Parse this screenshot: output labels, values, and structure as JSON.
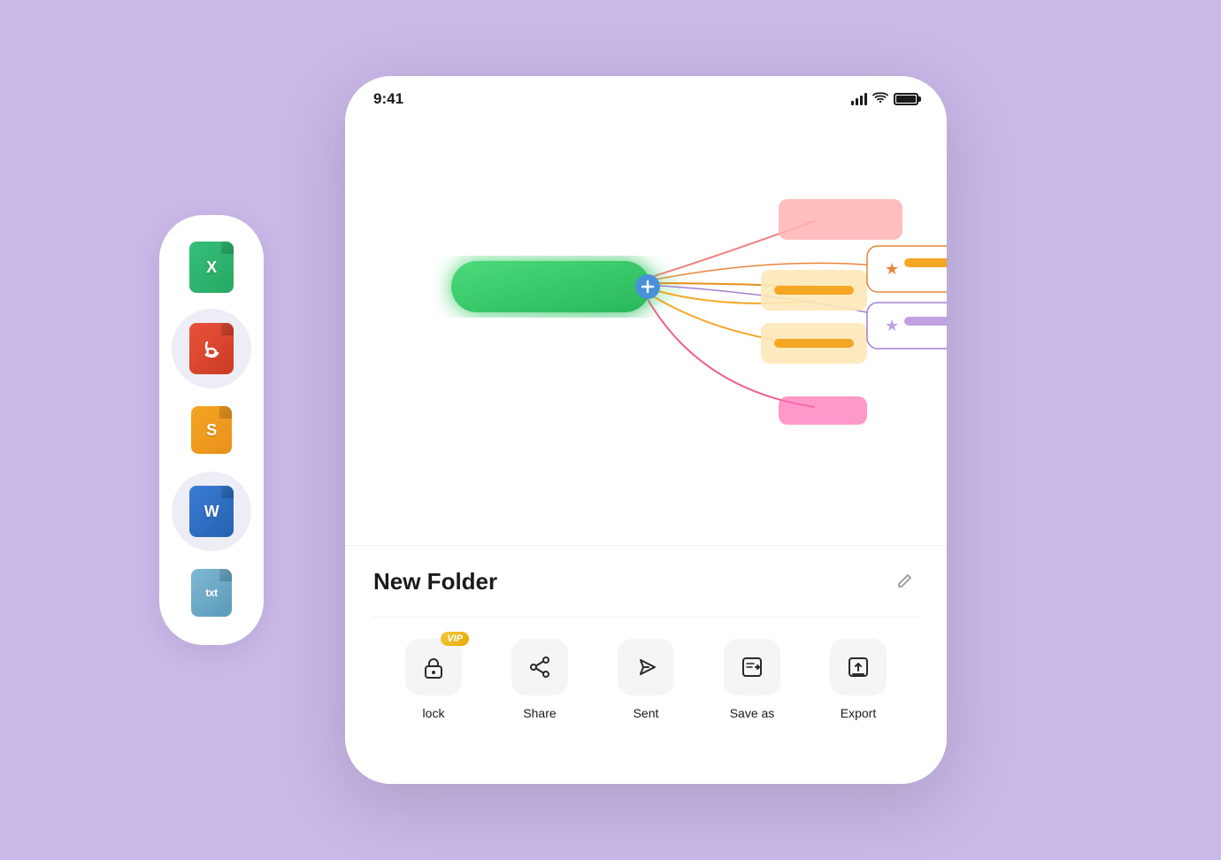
{
  "background_color": "#c9b8e8",
  "status_bar": {
    "time": "9:41",
    "signal_label": "signal",
    "wifi_label": "wifi",
    "battery_label": "battery"
  },
  "file_icons": [
    {
      "id": "excel",
      "letter": "X",
      "type": "xl",
      "active": false
    },
    {
      "id": "pdf",
      "letter": "",
      "type": "pdf",
      "active": true
    },
    {
      "id": "slides",
      "letter": "S",
      "type": "s",
      "active": false
    },
    {
      "id": "word",
      "letter": "W",
      "type": "word",
      "active": true
    },
    {
      "id": "txt",
      "letter": "txt",
      "type": "txt",
      "active": false
    }
  ],
  "mindmap": {
    "center_label": "",
    "nodes": [
      "",
      "",
      "",
      "",
      ""
    ]
  },
  "folder": {
    "name": "New Folder",
    "edit_label": "edit"
  },
  "actions": [
    {
      "id": "lock",
      "label": "lock",
      "has_vip": true
    },
    {
      "id": "share",
      "label": "Share",
      "has_vip": false
    },
    {
      "id": "sent",
      "label": "Sent",
      "has_vip": false
    },
    {
      "id": "save-as",
      "label": "Save as",
      "has_vip": false
    },
    {
      "id": "export",
      "label": "Export",
      "has_vip": false
    }
  ],
  "vip_badge_text": "VIP"
}
